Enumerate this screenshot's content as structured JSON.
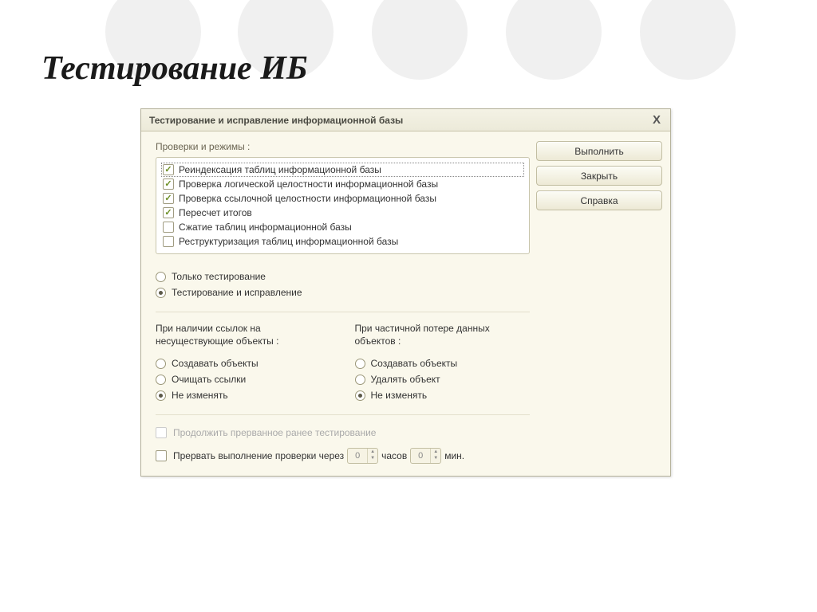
{
  "slide": {
    "title": "Тестирование ИБ"
  },
  "dialog": {
    "title": "Тестирование и исправление информационной базы",
    "close_icon": "X",
    "buttons": {
      "execute": "Выполнить",
      "close": "Закрыть",
      "help": "Справка"
    },
    "section": {
      "checks_label": "Проверки и режимы :",
      "checks": [
        {
          "label": "Реиндексация таблиц информационной базы",
          "checked": true,
          "focused": true
        },
        {
          "label": "Проверка логической целостности информационной базы",
          "checked": true,
          "focused": false
        },
        {
          "label": "Проверка ссылочной целостности информационной базы",
          "checked": true,
          "focused": false
        },
        {
          "label": "Пересчет итогов",
          "checked": true,
          "focused": false
        },
        {
          "label": "Сжатие таблиц информационной базы",
          "checked": false,
          "focused": false
        },
        {
          "label": "Реструктуризация таблиц информационной базы",
          "checked": false,
          "focused": false
        }
      ]
    },
    "mode": {
      "options": [
        {
          "label": "Только тестирование",
          "selected": false
        },
        {
          "label": "Тестирование и исправление",
          "selected": true
        }
      ]
    },
    "ref_fix": {
      "left_heading": "При наличии ссылок на несуществующие объекты :",
      "right_heading": "При частичной потере данных объектов :",
      "left_options": [
        {
          "label": "Создавать объекты",
          "selected": false
        },
        {
          "label": "Очищать ссылки",
          "selected": false
        },
        {
          "label": "Не изменять",
          "selected": true
        }
      ],
      "right_options": [
        {
          "label": "Создавать объекты",
          "selected": false
        },
        {
          "label": "Удалять объект",
          "selected": false
        },
        {
          "label": "Не изменять",
          "selected": true
        }
      ]
    },
    "footer": {
      "resume_label": "Продолжить прерванное ранее тестирование",
      "interrupt_label_prefix": "Прервать выполнение проверки через",
      "hours_suffix": "часов",
      "minutes_suffix": "мин.",
      "hours_value": "0",
      "minutes_value": "0"
    }
  }
}
